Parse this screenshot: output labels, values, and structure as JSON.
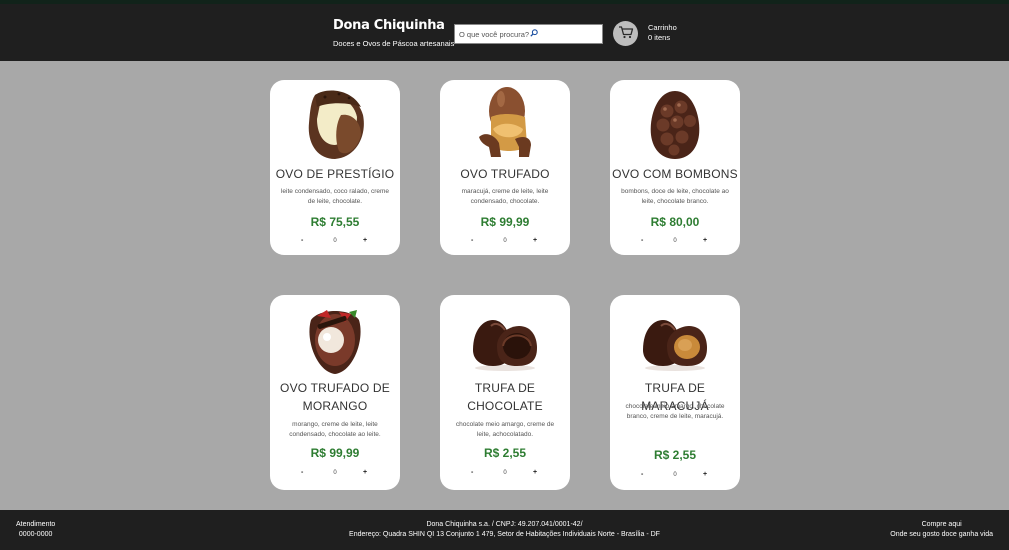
{
  "header": {
    "brand_name": "Dona Chiquinha",
    "brand_subtitle": "Doces e Ovos de Páscoa artesanais",
    "search_placeholder": "O que você procura?",
    "cart_label": "Carrinho",
    "cart_count": "0 itens"
  },
  "products": [
    {
      "title": "OVO DE PRESTÍGIO",
      "description": "leite condensado, coco ralado, creme de leite, chocolate.",
      "price": "R$ 75,55",
      "minus": "-",
      "qty": "0",
      "plus": "+"
    },
    {
      "title": "OVO TRUFADO",
      "description": "maracujá, creme de leite, leite condensado, chocolate.",
      "price": "R$ 99,99",
      "minus": "-",
      "qty": "0",
      "plus": "+"
    },
    {
      "title": "OVO COM BOMBONS",
      "description": "bombons, doce de leite, chocolate ao leite, chocolate branco.",
      "price": "R$ 80,00",
      "minus": "-",
      "qty": "0",
      "plus": "+"
    },
    {
      "title": "OVO TRUFADO DE MORANGO",
      "description": "morango, creme de leite, leite condensado, chocolate ao leite.",
      "price": "R$ 99,99",
      "minus": "-",
      "qty": "0",
      "plus": "+"
    },
    {
      "title": "TRUFA DE CHOCOLATE",
      "description": "chocolate meio amargo, creme de leite, achocolatado.",
      "price": "R$ 2,55",
      "minus": "-",
      "qty": "0",
      "plus": "+"
    },
    {
      "title": "TRUFA DE MARACUJÁ",
      "description": "chocolate meio amargo, chocolate branco, creme de leite, maracujá.",
      "price": "R$ 2,55",
      "minus": "-",
      "qty": "0",
      "plus": "+"
    }
  ],
  "footer": {
    "left_title": "Atendimento",
    "left_phone": "0000-0000",
    "company": "Dona Chiquinha s.a. / CNPJ: 49.207.041/0001-42/",
    "address": "Endereço: Quadra SHIN QI 13 Conjunto 1 479, Setor de Habitações Individuais Norte - Brasília - DF",
    "right_title": "Compre aqui",
    "right_slogan": "Onde seu gosto doce ganha vida"
  },
  "colors": {
    "header_bg": "#1f1f1f",
    "page_bg": "#a8a8a8",
    "price_green": "#2e7d32"
  }
}
